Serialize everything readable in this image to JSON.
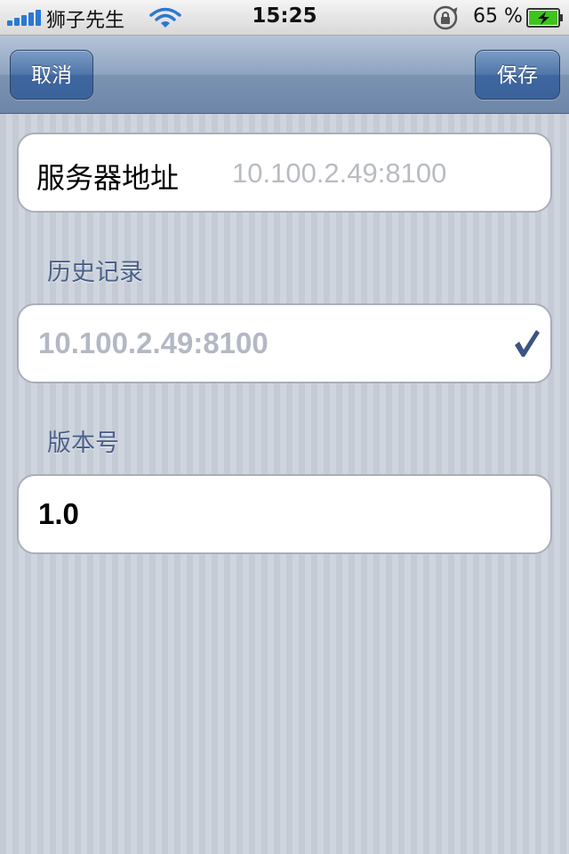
{
  "status_bar": {
    "carrier": "狮子先生",
    "time": "15:25",
    "battery_percent": "65 %",
    "signal_icon": "signal-bars-icon",
    "wifi_icon": "wifi-icon",
    "rotation_lock_icon": "rotation-lock-icon",
    "battery_icon": "battery-charging-icon"
  },
  "nav_bar": {
    "cancel_label": "取消",
    "save_label": "保存"
  },
  "server": {
    "label": "服务器地址",
    "placeholder": "10.100.2.49:8100",
    "value": ""
  },
  "history": {
    "header": "历史记录",
    "items": [
      {
        "value": "10.100.2.49:8100",
        "selected": true
      }
    ]
  },
  "version": {
    "header": "版本号",
    "value": "1.0"
  },
  "colors": {
    "nav_button": "#3e66a0",
    "section_header": "#4b6189",
    "checkmark": "#3c5482",
    "placeholder": "#b8bcc2",
    "battery_fill": "#3ec41c"
  }
}
